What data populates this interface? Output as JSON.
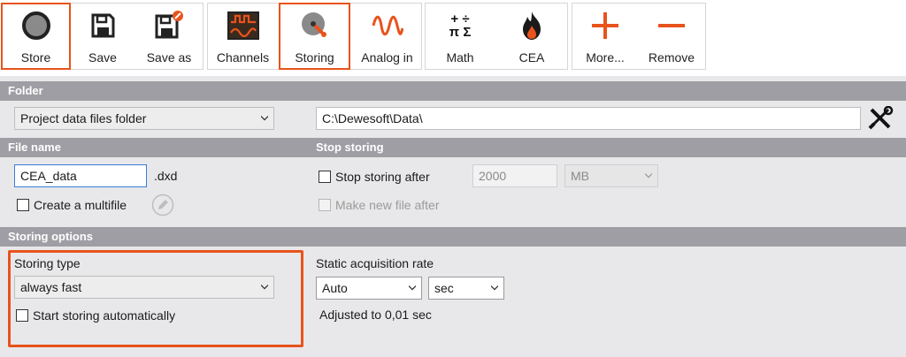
{
  "toolbar": {
    "store": "Store",
    "save": "Save",
    "save_as": "Save as",
    "channels": "Channels",
    "storing": "Storing",
    "analog_in": "Analog in",
    "math": "Math",
    "math_glyphs_top": "+ ÷",
    "math_glyphs_bottom": "π Σ",
    "cea": "CEA",
    "more": "More...",
    "remove": "Remove"
  },
  "folder": {
    "header": "Folder",
    "location": "Project data files folder",
    "path": "C:\\Dewesoft\\Data\\"
  },
  "file_name": {
    "header": "File name",
    "value": "CEA_data",
    "extension": ".dxd",
    "multifile_label": "Create a multifile"
  },
  "stop_storing": {
    "header": "Stop storing",
    "stop_after_label": "Stop storing after",
    "amount": "2000",
    "unit": "MB",
    "new_file_label": "Make new file after"
  },
  "storing_options": {
    "header": "Storing options",
    "type_label": "Storing type",
    "type_value": "always fast",
    "auto_start_label": "Start storing automatically",
    "rate_label": "Static acquisition rate",
    "rate_value": "Auto",
    "rate_unit": "sec",
    "adjusted_text": "Adjusted to 0,01 sec"
  },
  "colors": {
    "accent": "#e8531c",
    "section_header": "#9e9ea4",
    "panel_bg": "#e8e8ea"
  }
}
